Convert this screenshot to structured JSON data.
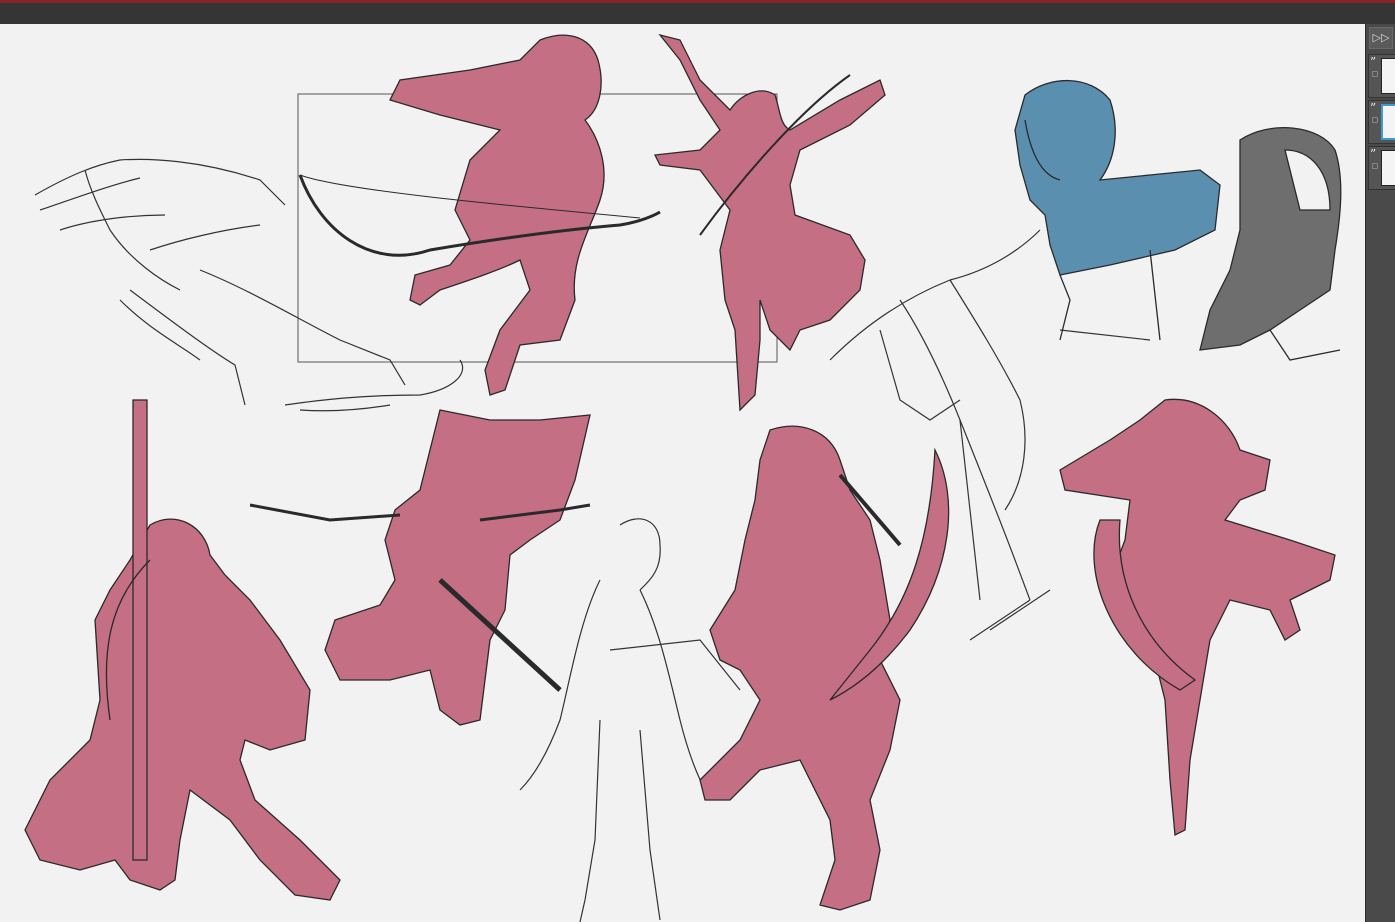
{
  "window": {
    "title_bar_color": "#353535",
    "accent_color": "#8a2424"
  },
  "canvas": {
    "background_color": "#f2f2f2",
    "fill_colors": {
      "pink": "#c46f83",
      "blue": "#5b8fb0",
      "gray": "#6e6e6e"
    },
    "line_color": "#2a2a2a"
  },
  "right_panel": {
    "collapse_icon": "double-chevron-right-icon",
    "collapse_glyph": "▷▷",
    "layers": [
      {
        "icon_glyph": "”",
        "icon": "layer-visibility-icon",
        "lock_icon": "lock-icon",
        "active": false
      },
      {
        "icon_glyph": "”",
        "icon": "layer-visibility-icon",
        "lock_icon": "lock-icon",
        "active": true
      },
      {
        "icon_glyph": "”",
        "icon": "layer-visibility-icon",
        "lock_icon": "lock-icon",
        "active": false
      }
    ]
  }
}
